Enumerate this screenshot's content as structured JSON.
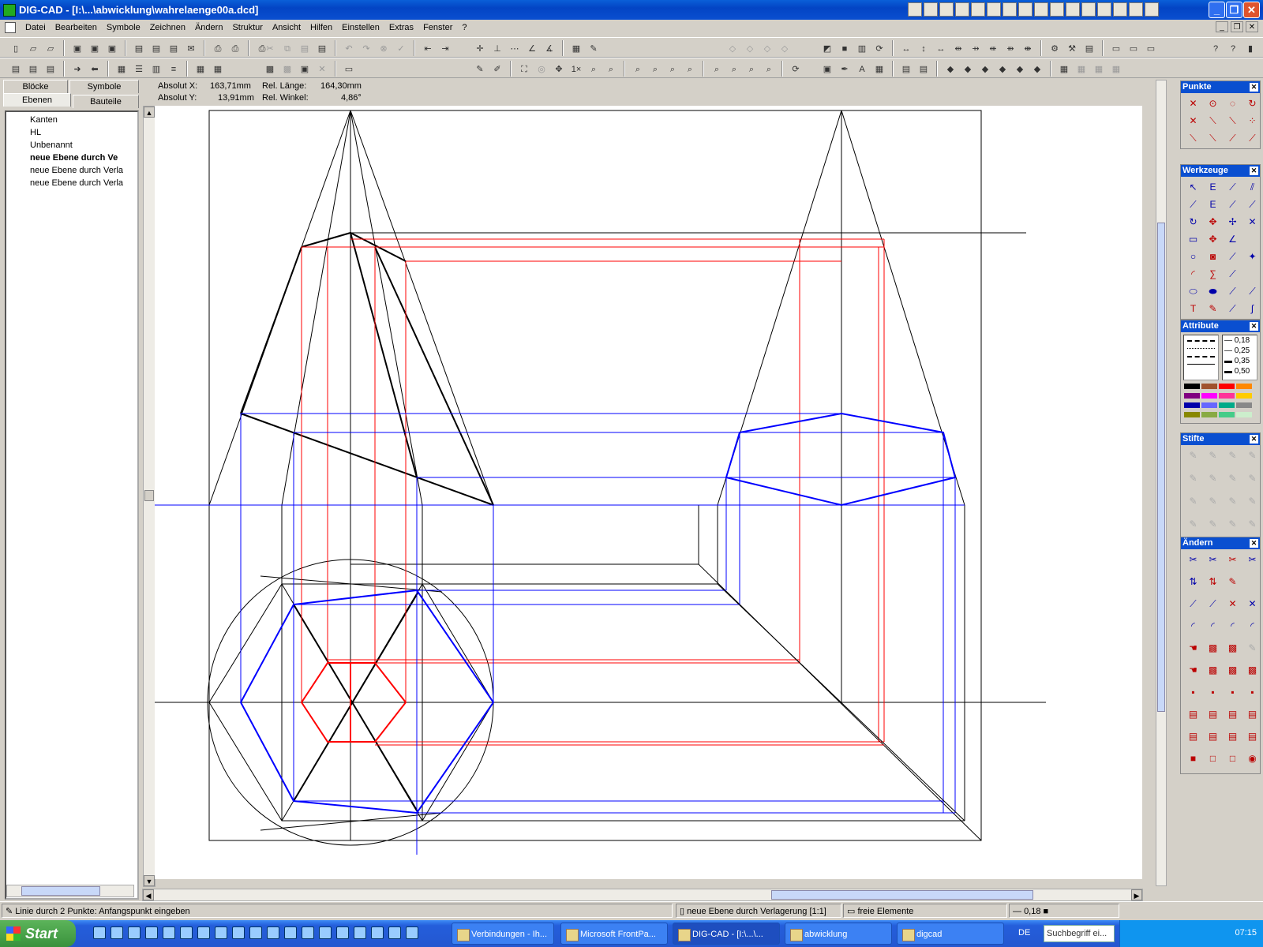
{
  "window": {
    "title": "DIG-CAD - [I:\\...\\abwicklung\\wahrelaenge00a.dcd]"
  },
  "menu": [
    "Datei",
    "Bearbeiten",
    "Symbole",
    "Zeichnen",
    "Ändern",
    "Struktur",
    "Ansicht",
    "Hilfen",
    "Einstellen",
    "Extras",
    "Fenster",
    "?"
  ],
  "tabs": {
    "bloecke": "Blöcke",
    "symbole": "Symbole",
    "ebenen": "Ebenen",
    "bauteile": "Bauteile"
  },
  "layers": [
    {
      "name": "Kanten",
      "bold": false
    },
    {
      "name": "HL",
      "bold": false
    },
    {
      "name": "Unbenannt",
      "bold": false
    },
    {
      "name": "neue Ebene durch Ve",
      "bold": true
    },
    {
      "name": "neue Ebene durch Verla",
      "bold": false
    },
    {
      "name": "neue Ebene durch Verla",
      "bold": false
    }
  ],
  "coords": {
    "abs_x_label": "Absolut X:",
    "abs_x": "163,71mm",
    "abs_y_label": "Absolut Y:",
    "abs_y": "13,91mm",
    "rel_len_label": "Rel. Länge:",
    "rel_len": "164,30mm",
    "rel_angle_label": "Rel. Winkel:",
    "rel_angle": "4,86°"
  },
  "palettes": {
    "punkte": "Punkte",
    "werkzeuge": "Werkzeuge",
    "attribute": "Attribute",
    "stifte": "Stifte",
    "aendern": "Ändern"
  },
  "line_widths": [
    "0,18",
    "0,25",
    "0,35",
    "0,50"
  ],
  "status": {
    "hint": "Linie durch 2 Punkte: Anfangspunkt eingeben",
    "layer": "neue Ebene durch Verlagerung [1:1]",
    "elements": "freie Elemente",
    "width": "0,18"
  },
  "taskbar": {
    "start": "Start",
    "tasks": [
      "Verbindungen - Ih...",
      "Microsoft FrontPa...",
      "DIG-CAD - [I:\\...\\...",
      "abwicklung",
      "digcad"
    ],
    "lang": "DE",
    "search": "Suchbegriff ei...",
    "clock": "07:15"
  },
  "colors": {
    "construction": "#000000",
    "red_lines": "#ff0000",
    "blue_lines": "#0000ff",
    "titlebar": "#0a4fd0"
  }
}
